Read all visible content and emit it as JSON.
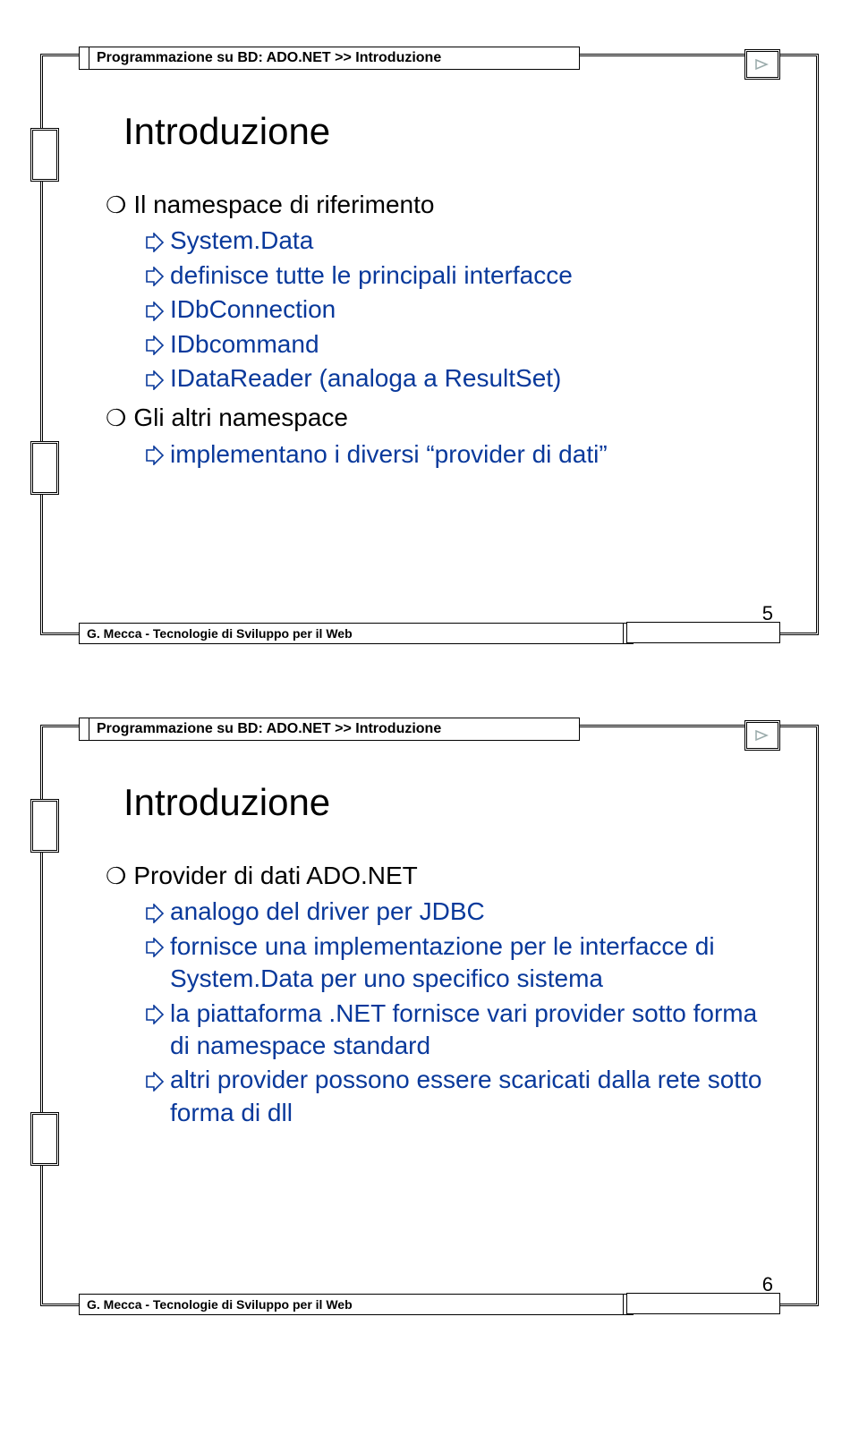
{
  "slide1": {
    "breadcrumb": "Programmazione su BD: ADO.NET >> Introduzione",
    "title": "Introduzione",
    "bullets": [
      {
        "level": 1,
        "text": "Il namespace di riferimento"
      },
      {
        "level": 2,
        "text": "System.Data"
      },
      {
        "level": 2,
        "text": "definisce tutte le principali interfacce"
      },
      {
        "level": 2,
        "text": "IDbConnection"
      },
      {
        "level": 2,
        "text": "IDbcommand"
      },
      {
        "level": 2,
        "text": "IDataReader (analoga a ResultSet)"
      },
      {
        "level": 1,
        "text": "Gli altri namespace"
      },
      {
        "level": 2,
        "text": "implementano i diversi “provider di dati”"
      }
    ],
    "footer": "G. Mecca - Tecnologie di Sviluppo per il Web",
    "page": "5"
  },
  "slide2": {
    "breadcrumb": "Programmazione su BD: ADO.NET >> Introduzione",
    "title": "Introduzione",
    "bullets": [
      {
        "level": 1,
        "text": "Provider di dati ADO.NET"
      },
      {
        "level": 2,
        "text": "analogo del driver per JDBC"
      },
      {
        "level": 2,
        "text": "fornisce una implementazione per le interfacce di System.Data per uno specifico sistema"
      },
      {
        "level": 2,
        "text": "la piattaforma .NET fornisce vari provider sotto forma di namespace standard"
      },
      {
        "level": 2,
        "text": "altri provider possono essere scaricati dalla rete sotto forma di dll"
      }
    ],
    "footer": "G. Mecca - Tecnologie di Sviluppo per il Web",
    "page": "6"
  }
}
